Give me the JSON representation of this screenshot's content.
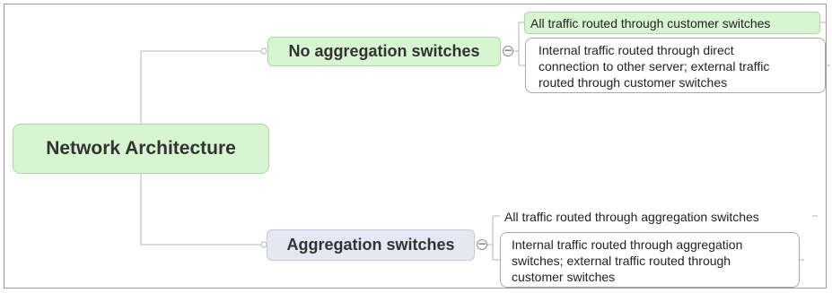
{
  "map": {
    "root": {
      "label": "Network Architecture"
    },
    "branches": [
      {
        "label": "No aggregation switches",
        "collapse_symbol": "−",
        "children": [
          {
            "text": "All traffic routed through customer switches",
            "selected": true
          },
          {
            "lines": [
              "Internal traffic routed through direct",
              "connection to other server; external traffic",
              "routed through customer switches"
            ]
          }
        ]
      },
      {
        "label": "Aggregation switches",
        "collapse_symbol": "−",
        "children": [
          {
            "text": "All traffic routed through aggregation switches"
          },
          {
            "lines": [
              "Internal traffic routed through aggregation",
              "switches; external traffic routed through",
              "customer switches"
            ]
          }
        ]
      }
    ]
  },
  "colors": {
    "selected_fill": "#d8f5d2",
    "selected_border": "#a9d8a0",
    "branch2_fill": "#e5e7f2",
    "connector": "#b5b5b5"
  }
}
